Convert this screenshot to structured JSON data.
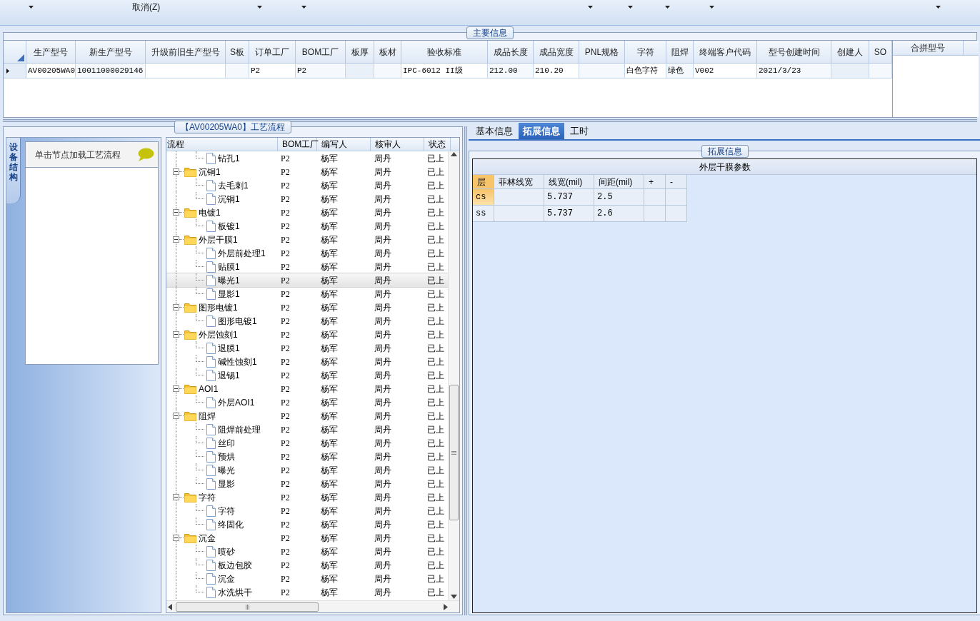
{
  "toolbar": {
    "cancel_button": "取消(Z)"
  },
  "main_info": {
    "title": "主要信息",
    "columns": [
      "生产型号",
      "新生产型号",
      "升级前旧生产型号",
      "S板",
      "订单工厂",
      "BOM工厂",
      "板厚",
      "板材",
      "验收标准",
      "成品长度",
      "成品宽度",
      "PNL规格",
      "字符",
      "阻焊",
      "终端客户代码",
      "型号创建时间",
      "创建人",
      "SO"
    ],
    "rows": [
      {
        "selected": true,
        "cells": [
          "AV00205WA0",
          "10011000029146",
          null,
          null,
          "P2",
          "P2",
          null,
          null,
          "IPC-6012 II级",
          "212.00",
          "210.20",
          null,
          "白色字符",
          "绿色",
          "V002",
          "2021/3/23",
          null,
          null
        ]
      }
    ],
    "merge_panel": {
      "title": "合拼型号"
    }
  },
  "process": {
    "title": "【AV00205WA0】工艺流程",
    "side_tab": "设备结构",
    "node_hint": "单击节点加载工艺流程",
    "columns": [
      "流程",
      "BOM工厂",
      "编写人",
      "核审人",
      "状态"
    ],
    "tree": [
      {
        "kind": "leaf",
        "label": "钻孔1",
        "bom": "P2",
        "writer": "杨军",
        "reviewer": "周丹",
        "status": "已上",
        "selected": false
      },
      {
        "kind": "folder",
        "label": "沉铜1",
        "bom": "P2",
        "writer": "杨军",
        "reviewer": "周丹",
        "status": "已上",
        "selected": false,
        "expanded": true,
        "children": [
          {
            "kind": "leaf",
            "label": "去毛刺1",
            "bom": "P2",
            "writer": "杨军",
            "reviewer": "周丹",
            "status": "已上",
            "selected": false
          },
          {
            "kind": "leaf",
            "label": "沉铜1",
            "bom": "P2",
            "writer": "杨军",
            "reviewer": "周丹",
            "status": "已上",
            "selected": false
          }
        ]
      },
      {
        "kind": "folder",
        "label": "电镀1",
        "bom": "P2",
        "writer": "杨军",
        "reviewer": "周丹",
        "status": "已上",
        "selected": false,
        "expanded": true,
        "children": [
          {
            "kind": "leaf",
            "label": "板镀1",
            "bom": "P2",
            "writer": "杨军",
            "reviewer": "周丹",
            "status": "已上",
            "selected": false
          }
        ]
      },
      {
        "kind": "folder",
        "label": "外层干膜1",
        "bom": "P2",
        "writer": "杨军",
        "reviewer": "周丹",
        "status": "已上",
        "selected": false,
        "expanded": true,
        "children": [
          {
            "kind": "leaf",
            "label": "外层前处理1",
            "bom": "P2",
            "writer": "杨军",
            "reviewer": "周丹",
            "status": "已上",
            "selected": false
          },
          {
            "kind": "leaf",
            "label": "贴膜1",
            "bom": "P2",
            "writer": "杨军",
            "reviewer": "周丹",
            "status": "已上",
            "selected": false
          },
          {
            "kind": "leaf",
            "label": "曝光1",
            "bom": "P2",
            "writer": "杨军",
            "reviewer": "周丹",
            "status": "已上",
            "selected": true
          },
          {
            "kind": "leaf",
            "label": "显影1",
            "bom": "P2",
            "writer": "杨军",
            "reviewer": "周丹",
            "status": "已上",
            "selected": false
          }
        ]
      },
      {
        "kind": "folder",
        "label": "图形电镀1",
        "bom": "P2",
        "writer": "杨军",
        "reviewer": "周丹",
        "status": "已上",
        "selected": false,
        "expanded": true,
        "children": [
          {
            "kind": "leaf",
            "label": "图形电镀1",
            "bom": "P2",
            "writer": "杨军",
            "reviewer": "周丹",
            "status": "已上",
            "selected": false
          }
        ]
      },
      {
        "kind": "folder",
        "label": "外层蚀刻1",
        "bom": "P2",
        "writer": "杨军",
        "reviewer": "周丹",
        "status": "已上",
        "selected": false,
        "expanded": true,
        "children": [
          {
            "kind": "leaf",
            "label": "退膜1",
            "bom": "P2",
            "writer": "杨军",
            "reviewer": "周丹",
            "status": "已上",
            "selected": false
          },
          {
            "kind": "leaf",
            "label": "碱性蚀刻1",
            "bom": "P2",
            "writer": "杨军",
            "reviewer": "周丹",
            "status": "已上",
            "selected": false
          },
          {
            "kind": "leaf",
            "label": "退锡1",
            "bom": "P2",
            "writer": "杨军",
            "reviewer": "周丹",
            "status": "已上",
            "selected": false
          }
        ]
      },
      {
        "kind": "folder",
        "label": "AOI1",
        "bom": "P2",
        "writer": "杨军",
        "reviewer": "周丹",
        "status": "已上",
        "selected": false,
        "expanded": true,
        "children": [
          {
            "kind": "leaf",
            "label": "外层AOI1",
            "bom": "P2",
            "writer": "杨军",
            "reviewer": "周丹",
            "status": "已上",
            "selected": false
          }
        ]
      },
      {
        "kind": "folder",
        "label": "阻焊",
        "bom": "P2",
        "writer": "杨军",
        "reviewer": "周丹",
        "status": "已上",
        "selected": false,
        "expanded": true,
        "children": [
          {
            "kind": "leaf",
            "label": "阻焊前处理",
            "bom": "P2",
            "writer": "杨军",
            "reviewer": "周丹",
            "status": "已上",
            "selected": false
          },
          {
            "kind": "leaf",
            "label": "丝印",
            "bom": "P2",
            "writer": "杨军",
            "reviewer": "周丹",
            "status": "已上",
            "selected": false
          },
          {
            "kind": "leaf",
            "label": "预烘",
            "bom": "P2",
            "writer": "杨军",
            "reviewer": "周丹",
            "status": "已上",
            "selected": false
          },
          {
            "kind": "leaf",
            "label": "曝光",
            "bom": "P2",
            "writer": "杨军",
            "reviewer": "周丹",
            "status": "已上",
            "selected": false
          },
          {
            "kind": "leaf",
            "label": "显影",
            "bom": "P2",
            "writer": "杨军",
            "reviewer": "周丹",
            "status": "已上",
            "selected": false
          }
        ]
      },
      {
        "kind": "folder",
        "label": "字符",
        "bom": "P2",
        "writer": "杨军",
        "reviewer": "周丹",
        "status": "已上",
        "selected": false,
        "expanded": true,
        "children": [
          {
            "kind": "leaf",
            "label": "字符",
            "bom": "P2",
            "writer": "杨军",
            "reviewer": "周丹",
            "status": "已上",
            "selected": false
          },
          {
            "kind": "leaf",
            "label": "终固化",
            "bom": "P2",
            "writer": "杨军",
            "reviewer": "周丹",
            "status": "已上",
            "selected": false
          }
        ]
      },
      {
        "kind": "folder",
        "label": "沉金",
        "bom": "P2",
        "writer": "杨军",
        "reviewer": "周丹",
        "status": "已上",
        "selected": false,
        "expanded": true,
        "children": [
          {
            "kind": "leaf",
            "label": "喷砂",
            "bom": "P2",
            "writer": "杨军",
            "reviewer": "周丹",
            "status": "已上",
            "selected": false
          },
          {
            "kind": "leaf",
            "label": "板边包胶",
            "bom": "P2",
            "writer": "杨军",
            "reviewer": "周丹",
            "status": "已上",
            "selected": false
          },
          {
            "kind": "leaf",
            "label": "沉金",
            "bom": "P2",
            "writer": "杨军",
            "reviewer": "周丹",
            "status": "已上",
            "selected": false
          },
          {
            "kind": "leaf",
            "label": "水洗烘干",
            "bom": "P2",
            "writer": "杨军",
            "reviewer": "周丹",
            "status": "已上",
            "selected": false
          }
        ]
      }
    ]
  },
  "detail_tabs": [
    {
      "label": "基本信息",
      "selected": false
    },
    {
      "label": "拓展信息",
      "selected": true
    },
    {
      "label": "工时",
      "selected": false
    }
  ],
  "extended_info": {
    "title": "拓展信息",
    "table_title": "外层干膜参数",
    "columns": [
      "层",
      "菲林线宽",
      "线宽(mil)",
      "间距(mil)",
      "+",
      "-"
    ],
    "rows": [
      {
        "selected": true,
        "cells": [
          "cs",
          null,
          "5.737",
          "2.5",
          null,
          null
        ]
      },
      {
        "selected": false,
        "cells": [
          "ss",
          null,
          "5.737",
          "2.6",
          null,
          null
        ]
      }
    ]
  }
}
